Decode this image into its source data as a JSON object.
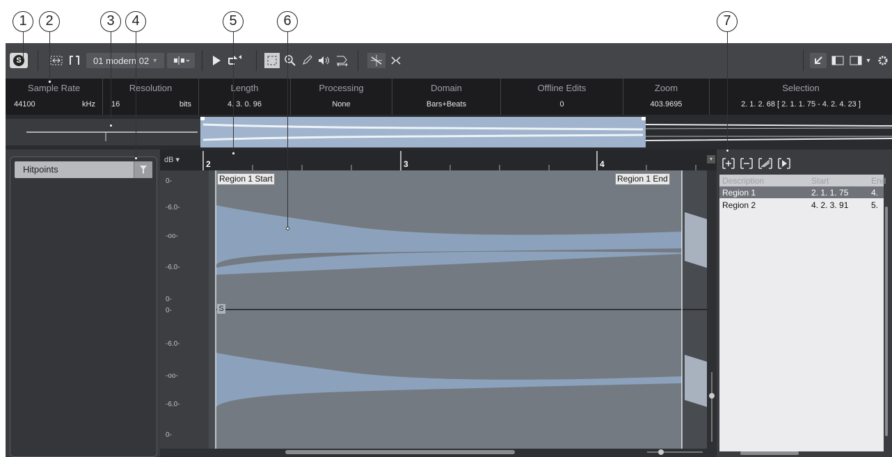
{
  "callouts": [
    "1",
    "2",
    "3",
    "4",
    "5",
    "6",
    "7"
  ],
  "toolbar": {
    "solo_label": "S",
    "audio_event": "01 modern 02",
    "dropdown_caret": "▾"
  },
  "infoline": [
    {
      "label": "Sample Rate",
      "value": "44100",
      "unit": "kHz"
    },
    {
      "label": "Resolution",
      "value": "16",
      "unit": "bits"
    },
    {
      "label": "Length",
      "value": "4. 3. 0. 96"
    },
    {
      "label": "Processing",
      "value": "None"
    },
    {
      "label": "Domain",
      "value": "Bars+Beats"
    },
    {
      "label": "Offline Edits",
      "value": "0"
    },
    {
      "label": "Zoom",
      "value": "403.9695"
    },
    {
      "label": "Selection",
      "value": "2. 1. 2. 68 [ 2. 1. 1. 75 - 4. 2. 4. 23 ]"
    }
  ],
  "left_panel": {
    "selector_label": "Hitpoints"
  },
  "ruler": {
    "db_unit": "dB",
    "bars": [
      "2",
      "3",
      "4"
    ]
  },
  "db_labels": [
    "0-",
    "-6.0-",
    "-oo-",
    "-6.0-",
    "0-",
    "0-",
    "-6.0-",
    "-oo-",
    "-6.0-",
    "0-"
  ],
  "markers": {
    "start": "Region 1 Start",
    "end": "Region 1 End",
    "snap": "S"
  },
  "regions": {
    "headers": [
      "Description",
      "Start",
      "End"
    ],
    "rows": [
      {
        "description": "Region 1",
        "start": "2. 1. 1. 75",
        "end": "4."
      },
      {
        "description": "Region 2",
        "start": "4. 2. 3. 91",
        "end": "5."
      }
    ]
  },
  "colors": {
    "waveform": "#8fa6c2",
    "accent_selection": "#a7bcd6"
  }
}
